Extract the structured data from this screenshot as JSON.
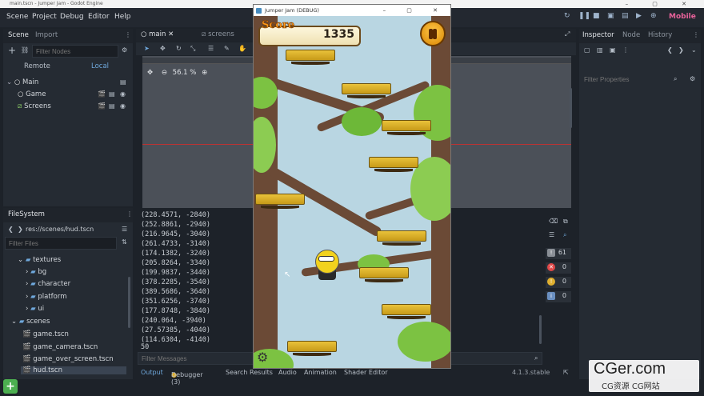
{
  "window": {
    "title": "main.tscn - Jumper Jam - Godot Engine",
    "controls": "– ▢ ✕"
  },
  "menubar": {
    "items": [
      "Scene",
      "Project",
      "Debug",
      "Editor",
      "Help"
    ],
    "renderer": "Mobile"
  },
  "scene_dock": {
    "tabs": [
      "Scene",
      "Import"
    ],
    "filter_placeholder": "Filter Nodes",
    "remote_label": "Remote",
    "local_label": "Local",
    "tree": [
      {
        "name": "Main",
        "icon": "node-icon"
      },
      {
        "name": "Game",
        "icon": "node-icon"
      },
      {
        "name": "Screens",
        "icon": "control-icon"
      }
    ]
  },
  "editor_tabs": [
    "main",
    "screens"
  ],
  "viewport": {
    "zoom": "56.1 %"
  },
  "filesystem": {
    "tab": "FileSystem",
    "path": "res://scenes/hud.tscn",
    "filter_placeholder": "Filter Files",
    "items": [
      {
        "label": "textures",
        "level": 1,
        "type": "folder"
      },
      {
        "label": "bg",
        "level": 2,
        "type": "folder"
      },
      {
        "label": "character",
        "level": 2,
        "type": "folder"
      },
      {
        "label": "platform",
        "level": 2,
        "type": "folder"
      },
      {
        "label": "ui",
        "level": 2,
        "type": "folder"
      },
      {
        "label": "scenes",
        "level": 0,
        "type": "folder"
      },
      {
        "label": "game.tscn",
        "level": 1,
        "type": "scene"
      },
      {
        "label": "game_camera.tscn",
        "level": 1,
        "type": "scene"
      },
      {
        "label": "game_over_screen.tscn",
        "level": 1,
        "type": "scene"
      },
      {
        "label": "hud.tscn",
        "level": 1,
        "type": "scene"
      }
    ]
  },
  "console": {
    "lines": [
      "(228.4571, -2840)",
      "(252.8861, -2940)",
      "(216.9645, -3040)",
      "(261.4733, -3140)",
      "(174.1382, -3240)",
      "(205.8264, -3340)",
      "(199.9837, -3440)",
      "(378.2285, -3540)",
      "(389.5686, -3640)",
      "(351.6256, -3740)",
      "(177.8748, -3840)",
      "(240.064, -3940)",
      "(27.57385, -4040)",
      "(114.6304, -4140)",
      "50"
    ],
    "filter_placeholder": "Filter Messages"
  },
  "console_badges": [
    {
      "count": "61",
      "color": "#8a8f96",
      "icon": "message-icon"
    },
    {
      "count": "0",
      "color": "#e04848",
      "icon": "error-icon"
    },
    {
      "count": "0",
      "color": "#e0b030",
      "icon": "warning-icon"
    },
    {
      "count": "0",
      "color": "#6a8fc0",
      "icon": "info-icon"
    }
  ],
  "bottom_tabs": [
    "Output",
    "Debugger (3)",
    "Search Results",
    "Audio",
    "Animation",
    "Shader Editor"
  ],
  "version": "4.1.3.stable",
  "inspector": {
    "tabs": [
      "Inspector",
      "Node",
      "History"
    ],
    "filter_placeholder": "Filter Properties"
  },
  "game_window": {
    "title": "Jumper Jam (DEBUG)",
    "score_label": "Score",
    "score_value": "1335"
  },
  "watermark": {
    "main": "CGer.com",
    "sub": "CG资源 CG网站"
  },
  "colors": {
    "accent": "#6fa8dc",
    "renderer": "#e8629a"
  }
}
